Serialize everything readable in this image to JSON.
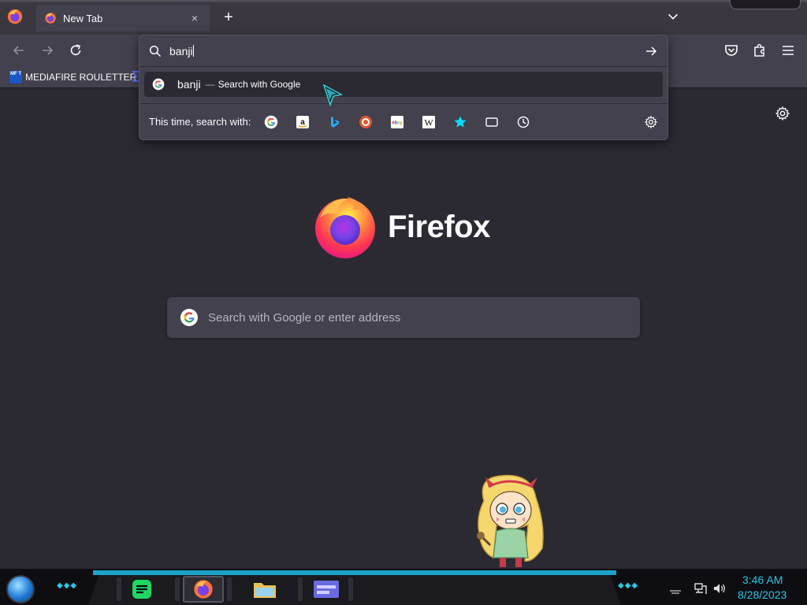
{
  "browser": {
    "tab": {
      "title": "New Tab",
      "close_glyph": "×"
    },
    "new_tab_glyph": "+",
    "icons": {
      "app_menu": "firefox-logo-icon",
      "back": "back-arrow-icon",
      "forward": "forward-arrow-icon",
      "reload": "reload-icon",
      "pocket": "pocket-icon",
      "extensions": "puzzle-icon",
      "menu": "hamburger-menu-icon",
      "tab_list": "chevron-down-icon"
    }
  },
  "bookmarks": {
    "items": [
      {
        "label": "MEDIAFIRE ROULETTER",
        "badge": "MF T"
      }
    ]
  },
  "urlbar": {
    "value": "banji",
    "suggestion": {
      "term": "banji",
      "separator": "—",
      "action": "Search with Google"
    },
    "one_off_label": "This time, search with:",
    "engines": [
      "Google",
      "Amazon",
      "Bing",
      "DuckDuckGo",
      "eBay",
      "Wikipedia",
      "Bookmarks",
      "Tabs",
      "History"
    ]
  },
  "newtab": {
    "wordmark": "Firefox",
    "search_placeholder": "Search with Google or enter address"
  },
  "taskbar": {
    "apps": [
      "Notes",
      "Firefox",
      "File Explorer",
      "Window Manager"
    ],
    "time": "3:46 AM",
    "date": "8/28/2023",
    "accent": "#29c6e8"
  },
  "colors": {
    "page_bg": "#2b2a33",
    "toolbar_bg": "#42414d",
    "text": "#fbfbfe"
  }
}
